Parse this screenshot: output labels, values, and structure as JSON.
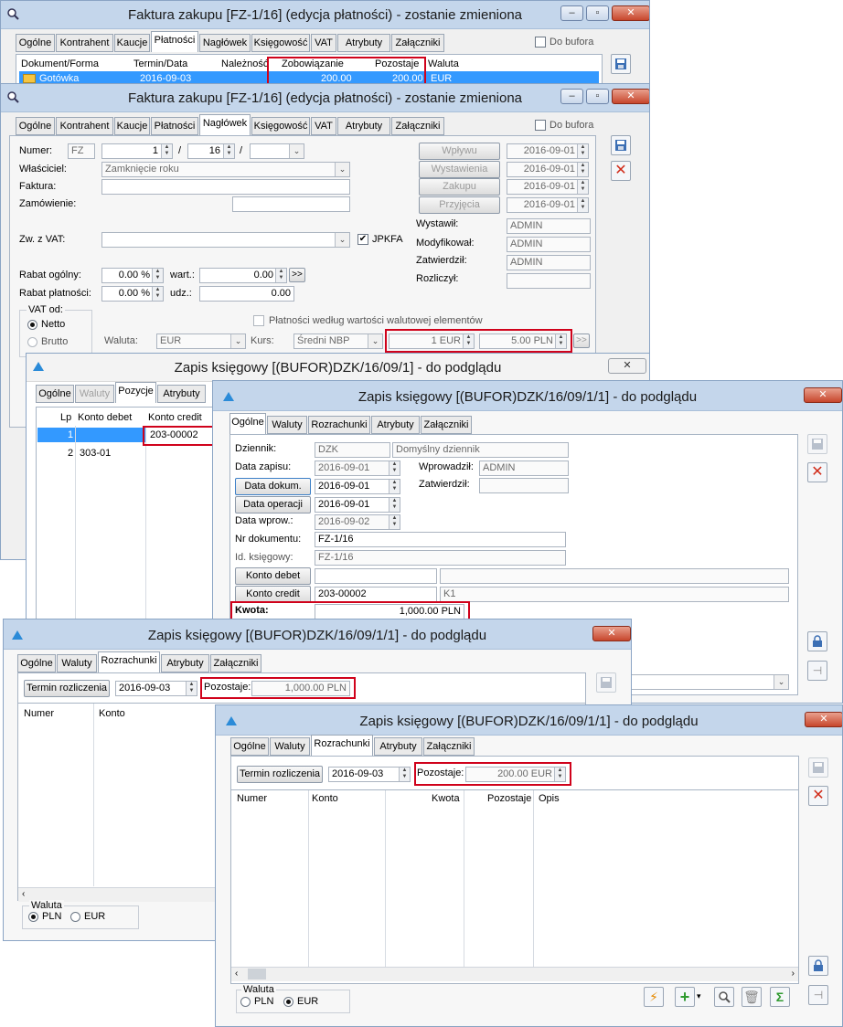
{
  "w1": {
    "title": "Faktura zakupu [FZ-1/16] (edycja płatności) - zostanie zmieniona",
    "tabs": [
      "Ogólne",
      "Kontrahent",
      "Kaucje",
      "Płatności",
      "Nagłówek",
      "Księgowość",
      "VAT",
      "Atrybuty",
      "Załączniki"
    ],
    "do_bufora": "Do bufora",
    "columns": [
      "Dokument/Forma",
      "Termin/Data",
      "Należność",
      "Zobowiązanie",
      "Pozostaje",
      "Waluta"
    ],
    "row": {
      "forma": "Gotówka",
      "termin": "2016-09-03",
      "naleznosc": "",
      "zobowiazanie": "200.00",
      "pozostaje": "200.00",
      "waluta": "EUR"
    }
  },
  "w2": {
    "title": "Faktura zakupu [FZ-1/16] (edycja płatności) - zostanie zmieniona",
    "tabs": [
      "Ogólne",
      "Kontrahent",
      "Kaucje",
      "Płatności",
      "Nagłówek",
      "Księgowość",
      "VAT",
      "Atrybuty",
      "Załączniki"
    ],
    "do_bufora": "Do bufora",
    "numer_label": "Numer:",
    "numer": {
      "prefix": "FZ",
      "n": "1",
      "sep": "/",
      "year": "16",
      "suffix": ""
    },
    "wlasciciel_label": "Właściciel:",
    "wlasciciel": "Zamknięcie roku",
    "faktura_label": "Faktura:",
    "zamowienie_label": "Zamówienie:",
    "zw_vat_label": "Zw. z VAT:",
    "jpkfa": "JPKFA",
    "rabat_ogolny_label": "Rabat ogólny:",
    "rabat_ogolny": "0.00 %",
    "wart_label": "wart.:",
    "wart": "0.00",
    "rabat_platnosci_label": "Rabat płatności:",
    "rabat_platnosci": "0.00 %",
    "udz_label": "udz.:",
    "udz": "0.00",
    "more": ">>",
    "dates": [
      {
        "label": "Wpływu",
        "value": "2016-09-01"
      },
      {
        "label": "Wystawienia",
        "value": "2016-09-01"
      },
      {
        "label": "Zakupu",
        "value": "2016-09-01"
      },
      {
        "label": "Przyjęcia",
        "value": "2016-09-01"
      }
    ],
    "people": [
      {
        "label": "Wystawił:",
        "value": "ADMIN"
      },
      {
        "label": "Modyfikował:",
        "value": "ADMIN"
      },
      {
        "label": "Zatwierdził:",
        "value": "ADMIN"
      },
      {
        "label": "Rozliczył:",
        "value": ""
      }
    ],
    "vat_od_label": "VAT od:",
    "netto": "Netto",
    "brutto": "Brutto",
    "platnosci_wg": "Płatności według wartości walutowej elementów",
    "waluta_label": "Waluta:",
    "waluta": "EUR",
    "kurs_label": "Kurs:",
    "kurs_type": "Średni NBP",
    "kurs_from": "1 EUR",
    "kurs_to": "5.00 PLN"
  },
  "w3": {
    "title": "Zapis księgowy [(BUFOR)DZK/16/09/1] - do podglądu",
    "tabs": [
      "Ogólne",
      "Waluty",
      "Pozycje",
      "Atrybuty"
    ],
    "columns": [
      "Lp",
      "Konto debet",
      "Konto credit"
    ],
    "rows": [
      {
        "lp": "1",
        "debet": "",
        "credit": "203-00002"
      },
      {
        "lp": "2",
        "debet": "303-01",
        "credit": ""
      }
    ]
  },
  "w4": {
    "title": "Zapis księgowy [(BUFOR)DZK/16/09/1/1] - do podglądu",
    "tabs": [
      "Ogólne",
      "Waluty",
      "Rozrachunki",
      "Atrybuty",
      "Załączniki"
    ],
    "dziennik_label": "Dziennik:",
    "dziennik": "DZK",
    "dziennik_opis": "Domyślny dziennik",
    "data_zapisu_label": "Data zapisu:",
    "data_zapisu": "2016-09-01",
    "wprowadzil_label": "Wprowadził:",
    "wprowadzil": "ADMIN",
    "zatwierdzil_label": "Zatwierdził:",
    "zatwierdzil": "",
    "data_dokum_label": "Data dokum.",
    "data_dokum": "2016-09-01",
    "data_operacji_label": "Data operacji",
    "data_operacji": "2016-09-01",
    "data_wprow_label": "Data wprow.:",
    "data_wprow": "2016-09-02",
    "nr_dokumentu_label": "Nr dokumentu:",
    "nr_dokumentu": "FZ-1/16",
    "id_ksiegowy_label": "Id. księgowy:",
    "id_ksiegowy": "FZ-1/16",
    "konto_debet_label": "Konto debet",
    "konto_debet": "",
    "konto_credit_label": "Konto credit",
    "konto_credit": "203-00002",
    "konto_credit_opis": "K1",
    "kwota_label": "Kwota:",
    "kwota": "1,000.00 PLN"
  },
  "w5": {
    "title": "Zapis księgowy [(BUFOR)DZK/16/09/1/1] - do podglądu",
    "tabs": [
      "Ogólne",
      "Waluty",
      "Rozrachunki",
      "Atrybuty",
      "Załączniki"
    ],
    "termin_label": "Termin rozliczenia",
    "termin": "2016-09-03",
    "pozostaje_label": "Pozostaje:",
    "pozostaje": "1,000.00 PLN",
    "columns": [
      "Numer",
      "Konto"
    ],
    "waluta_label": "Waluta",
    "pln": "PLN",
    "eur": "EUR"
  },
  "w6": {
    "title": "Zapis księgowy [(BUFOR)DZK/16/09/1/1] - do podglądu",
    "tabs": [
      "Ogólne",
      "Waluty",
      "Rozrachunki",
      "Atrybuty",
      "Załączniki"
    ],
    "termin_label": "Termin rozliczenia",
    "termin": "2016-09-03",
    "pozostaje_label": "Pozostaje:",
    "pozostaje": "200.00 EUR",
    "columns": [
      "Numer",
      "Konto",
      "Kwota",
      "Pozostaje",
      "Opis"
    ],
    "waluta_label": "Waluta",
    "pln": "PLN",
    "eur": "EUR"
  },
  "colors": {
    "highlight": "#d0021b",
    "selection": "#3399ff",
    "titlebar": "#c4d6eb"
  },
  "icons": [
    "save-icon",
    "cancel-icon",
    "lock-icon",
    "pin-icon",
    "lightning-icon",
    "add-icon",
    "search-icon",
    "trash-icon",
    "sigma-icon"
  ]
}
